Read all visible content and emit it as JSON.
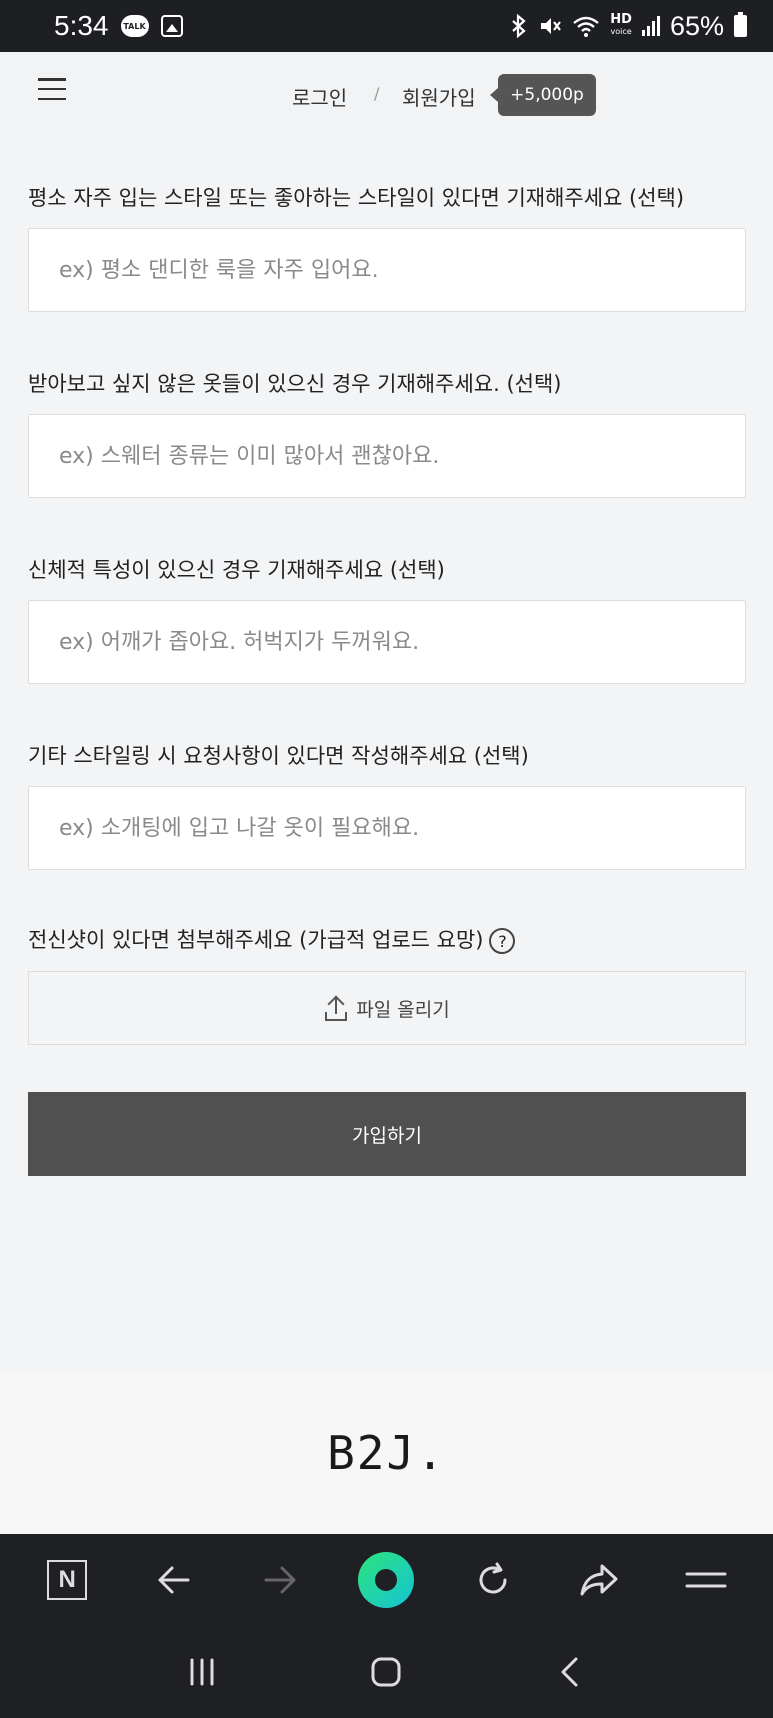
{
  "status_bar": {
    "time": "5:34",
    "talk_badge": "TALK",
    "hd_label": "HD",
    "voice_label": "voice",
    "battery_percent": "65%"
  },
  "header": {
    "login_label": "로그인",
    "separator": "/",
    "signup_label": "회원가입",
    "points_badge": "+5,000p"
  },
  "form": {
    "fields": [
      {
        "label": "평소 자주 입는 스타일 또는 좋아하는 스타일이 있다면 기재해주세요 (선택)",
        "placeholder": "ex) 평소 댄디한 룩을 자주 입어요.",
        "value": ""
      },
      {
        "label": "받아보고 싶지 않은 옷들이 있으신 경우 기재해주세요. (선택)",
        "placeholder": "ex) 스웨터 종류는 이미 많아서 괜찮아요.",
        "value": ""
      },
      {
        "label": "신체적 특성이 있으신 경우 기재해주세요 (선택)",
        "placeholder": "ex) 어깨가 좁아요. 허벅지가 두꺼워요.",
        "value": ""
      },
      {
        "label": "기타 스타일링 시 요청사항이 있다면 작성해주세요 (선택)",
        "placeholder": "ex) 소개팅에 입고 나갈 옷이 필요해요.",
        "value": ""
      }
    ],
    "photo_label": "전신샷이 있다면 첨부해주세요 (가급적 업로드 요망)",
    "help_glyph": "?",
    "upload_label": "파일 올리기",
    "submit_label": "가입하기"
  },
  "footer": {
    "logo": "B2J."
  },
  "browser_toolbar": {
    "home_label": "N"
  }
}
